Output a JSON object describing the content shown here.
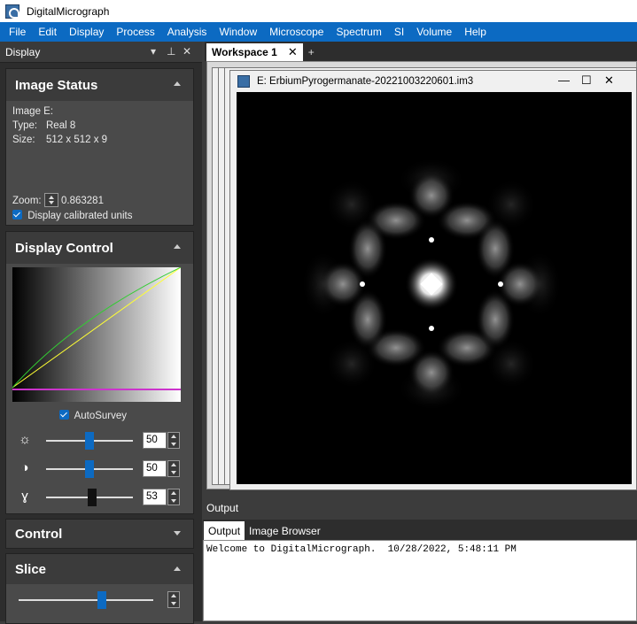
{
  "app": {
    "title": "DigitalMicrograph"
  },
  "menu": [
    "File",
    "Edit",
    "Display",
    "Process",
    "Analysis",
    "Window",
    "Microscope",
    "Spectrum",
    "SI",
    "Volume",
    "Help"
  ],
  "left_panel": {
    "title": "Display",
    "image_status": {
      "heading": "Image Status",
      "image_label": "Image E:",
      "type_label": "Type:",
      "type_value": "Real 8",
      "size_label": "Size:",
      "size_value": "512 x 512 x 9",
      "zoom_label": "Zoom:",
      "zoom_value": "0.863281",
      "calibrated_label": "Display calibrated units",
      "calibrated_checked": true
    },
    "display_control": {
      "heading": "Display Control",
      "autosurvey_label": "AutoSurvey",
      "autosurvey_checked": true,
      "sliders": [
        {
          "icon": "brightness-icon",
          "value": "50",
          "level": 0.5
        },
        {
          "icon": "contrast-icon",
          "value": "50",
          "level": 0.5
        },
        {
          "icon": "gamma-icon",
          "value": "53",
          "level": 0.53
        }
      ]
    },
    "control": {
      "heading": "Control"
    },
    "slice": {
      "heading": "Slice",
      "level": 0.62
    }
  },
  "workspace": {
    "tab_label": "Workspace 1",
    "add_label": "+",
    "image_window": {
      "title": "E: ErbiumPyrogermanate-20221003220601.im3"
    }
  },
  "output": {
    "title": "Output",
    "tabs": [
      "Output",
      "Image Browser"
    ],
    "active_tab": 0,
    "text": "Welcome to DigitalMicrograph.  10/28/2022, 5:48:11 PM"
  },
  "colors": {
    "accent": "#0c6ac2",
    "panel": "#4a4a4a",
    "dark": "#2d2d2d"
  }
}
